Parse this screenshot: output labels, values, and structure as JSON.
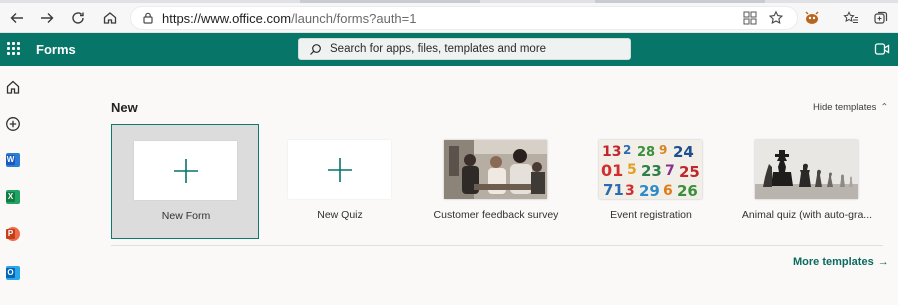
{
  "browser": {
    "url_host": "https://www.office.com",
    "url_path": "/launch/forms?auth=1"
  },
  "app": {
    "name": "Forms",
    "search_placeholder": "Search for apps, files, templates and more"
  },
  "main": {
    "section_title": "New",
    "hide_templates": "Hide templates",
    "more_templates": "More templates",
    "cards": [
      {
        "label": "New Form",
        "kind": "plus"
      },
      {
        "label": "New Quiz",
        "kind": "plus"
      },
      {
        "label": "Customer feedback survey",
        "kind": "photo-people"
      },
      {
        "label": "Event registration",
        "kind": "photo-numbers"
      },
      {
        "label": "Animal quiz (with auto-gra...",
        "kind": "photo-chess"
      }
    ]
  },
  "colors": {
    "brand": "#077568",
    "accent_text": "#0b6a5f"
  }
}
